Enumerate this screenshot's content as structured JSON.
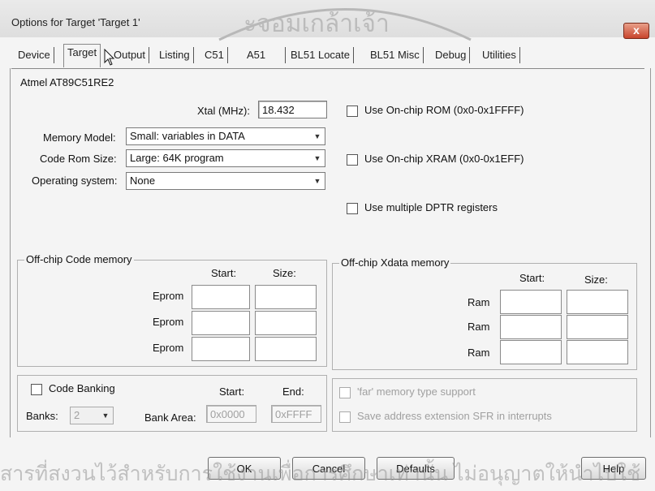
{
  "window": {
    "title": "Options for Target 'Target 1'",
    "close_label": "x"
  },
  "watermark": {
    "top_text": "ะจอมเกล้าเจ้า",
    "bottom_text": "สารที่สงวนไว้สำหรับการใช้งานเพื่อการศึกษาเท่านั้น ไม่อนุญาตให้นำไปใช้"
  },
  "tabs": [
    "Device",
    "Target",
    "Output",
    "Listing",
    "C51",
    "A51",
    "BL51 Locate",
    "BL51 Misc",
    "Debug",
    "Utilities"
  ],
  "active_tab": "Target",
  "device_name": "Atmel AT89C51RE2",
  "xtal": {
    "label": "Xtal (MHz):",
    "value": "18.432"
  },
  "memory_model": {
    "label": "Memory Model:",
    "value": "Small: variables in DATA"
  },
  "code_rom_size": {
    "label": "Code Rom Size:",
    "value": "Large: 64K program"
  },
  "operating_system": {
    "label": "Operating system:",
    "value": "None"
  },
  "options": {
    "onchip_rom": "Use On-chip ROM (0x0-0x1FFFF)",
    "onchip_xram": "Use On-chip XRAM (0x0-0x1EFF)",
    "multiple_dptr": "Use multiple DPTR registers"
  },
  "offchip_code": {
    "title": "Off-chip Code memory",
    "start_label": "Start:",
    "size_label": "Size:",
    "rows": [
      "Eprom",
      "Eprom",
      "Eprom"
    ]
  },
  "offchip_xdata": {
    "title": "Off-chip Xdata memory",
    "start_label": "Start:",
    "size_label": "Size:",
    "rows": [
      "Ram",
      "Ram",
      "Ram"
    ]
  },
  "banking": {
    "code_banking": "Code Banking",
    "start_label": "Start:",
    "end_label": "End:",
    "banks_label": "Banks:",
    "banks_value": "2",
    "bank_area_label": "Bank Area:",
    "bank_start": "0x0000",
    "bank_end": "0xFFFF"
  },
  "far": {
    "far_memory": "'far' memory type support",
    "save_address": "Save address extension SFR in interrupts"
  },
  "buttons": {
    "ok": "OK",
    "cancel": "Cancel",
    "defaults": "Defaults",
    "help": "Help"
  }
}
